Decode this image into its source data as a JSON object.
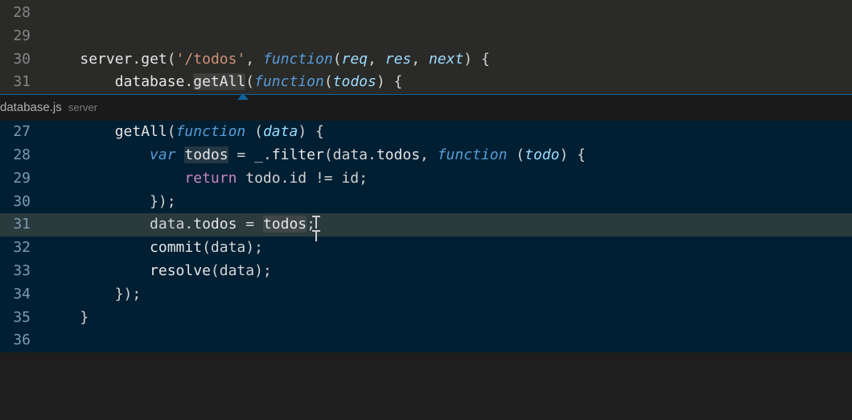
{
  "top_editor": {
    "lines": [
      {
        "num": "28",
        "tokens": []
      },
      {
        "num": "29",
        "tokens": []
      },
      {
        "num": "30",
        "tokens": [
          {
            "t": "ident",
            "v": "server"
          },
          {
            "t": "punct",
            "v": "."
          },
          {
            "t": "ident",
            "v": "get"
          },
          {
            "t": "punct",
            "v": "("
          },
          {
            "t": "str",
            "v": "'/todos'"
          },
          {
            "t": "punct",
            "v": ", "
          },
          {
            "t": "fn",
            "v": "function"
          },
          {
            "t": "punct",
            "v": "("
          },
          {
            "t": "param",
            "v": "req"
          },
          {
            "t": "punct",
            "v": ", "
          },
          {
            "t": "param",
            "v": "res"
          },
          {
            "t": "punct",
            "v": ", "
          },
          {
            "t": "param",
            "v": "next"
          },
          {
            "t": "punct",
            "v": ") {"
          }
        ],
        "indent": "    "
      },
      {
        "num": "31",
        "tokens": [
          {
            "t": "ident",
            "v": "database"
          },
          {
            "t": "punct",
            "v": "."
          },
          {
            "t": "ident",
            "v": "getAll",
            "hl": true
          },
          {
            "t": "punct",
            "v": "("
          },
          {
            "t": "fn",
            "v": "function"
          },
          {
            "t": "punct",
            "v": "("
          },
          {
            "t": "param",
            "v": "todos"
          },
          {
            "t": "punct",
            "v": ") {"
          }
        ],
        "indent": "        ",
        "defCaret": 295
      }
    ]
  },
  "peek": {
    "file": "database.js",
    "scope": "server",
    "lines": [
      {
        "num": "27",
        "tokens": [
          {
            "t": "ident",
            "v": "getAll"
          },
          {
            "t": "punct",
            "v": "("
          },
          {
            "t": "fn",
            "v": "function"
          },
          {
            "t": "punct",
            "v": " ("
          },
          {
            "t": "param",
            "v": "data"
          },
          {
            "t": "punct",
            "v": ") {"
          }
        ],
        "indent": "        "
      },
      {
        "num": "28",
        "tokens": [
          {
            "t": "kw2",
            "v": "var"
          },
          {
            "t": "punct",
            "v": " "
          },
          {
            "t": "ident",
            "v": "todos",
            "hl": true
          },
          {
            "t": "punct",
            "v": " = _."
          },
          {
            "t": "ident",
            "v": "filter"
          },
          {
            "t": "punct",
            "v": "(data."
          },
          {
            "t": "ident",
            "v": "todos"
          },
          {
            "t": "punct",
            "v": ", "
          },
          {
            "t": "fn",
            "v": "function"
          },
          {
            "t": "punct",
            "v": " ("
          },
          {
            "t": "param",
            "v": "todo"
          },
          {
            "t": "punct",
            "v": ") {"
          }
        ],
        "indent": "            "
      },
      {
        "num": "29",
        "tokens": [
          {
            "t": "kw",
            "v": "return"
          },
          {
            "t": "punct",
            "v": " todo.id != id;"
          }
        ],
        "indent": "                "
      },
      {
        "num": "30",
        "tokens": [
          {
            "t": "punct",
            "v": "});"
          }
        ],
        "indent": "            "
      },
      {
        "num": "31",
        "selected": true,
        "cursor": true,
        "tokens": [
          {
            "t": "punct",
            "v": "data."
          },
          {
            "t": "ident",
            "v": "todos"
          },
          {
            "t": "punct",
            "v": " = "
          },
          {
            "t": "ident",
            "v": "todos",
            "hl": true
          },
          {
            "t": "punct",
            "v": ";"
          }
        ],
        "indent": "            "
      },
      {
        "num": "32",
        "tokens": [
          {
            "t": "ident",
            "v": "commit"
          },
          {
            "t": "punct",
            "v": "(data);"
          }
        ],
        "indent": "            "
      },
      {
        "num": "33",
        "tokens": [
          {
            "t": "ident",
            "v": "resolve"
          },
          {
            "t": "punct",
            "v": "(data);"
          }
        ],
        "indent": "            "
      },
      {
        "num": "34",
        "tokens": [
          {
            "t": "punct",
            "v": "});"
          }
        ],
        "indent": "        "
      },
      {
        "num": "35",
        "tokens": [
          {
            "t": "punct",
            "v": "}"
          }
        ],
        "indent": "    "
      },
      {
        "num": "36",
        "tokens": []
      }
    ]
  }
}
